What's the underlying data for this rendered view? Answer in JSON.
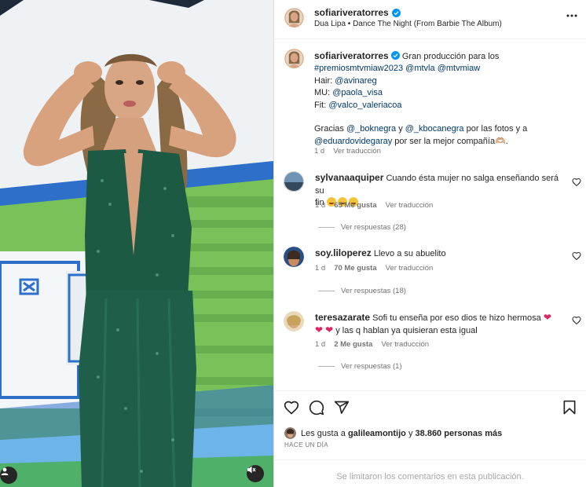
{
  "post": {
    "username": "sofiariveratorres",
    "audio": "Dua Lipa • Dance The Night (From Barbie The Album)"
  },
  "caption": {
    "username": "sofiariveratorres",
    "text_line1": "Gran producción para los",
    "line2_tag": "#premiosmtvmiaw2023",
    "line2_m1": "@mtvla",
    "line2_m2": "@mtvmiaw",
    "hair_label": "Hair:",
    "hair_mention": "@avinareg",
    "mu_label": "MU:",
    "mu_mention": "@paola_visa",
    "fit_label": "Fit:",
    "fit_mention": "@valco_valeriacoa",
    "thanks_1": "Gracias",
    "thanks_m1": "@_boknegra",
    "thanks_2": "y",
    "thanks_m2": "@_kbocanegra",
    "thanks_3": "por las fotos y a",
    "thanks_m3": "@eduardovidegaray",
    "thanks_4": "por ser la mejor compañía🫶🏼.",
    "time": "1 d",
    "see_translation": "Ver traducción"
  },
  "comments": [
    {
      "username": "sylvanaaquiper",
      "text": "Cuando ésta mujer no salga enseñando será su",
      "text2": "fin",
      "time": "1 d",
      "likes": "65 Me gusta",
      "see_translation": "Ver traducción",
      "replies": "Ver respuestas (28)"
    },
    {
      "username": "soy.liloperez",
      "text": "Llevo a su abuelito",
      "time": "1 d",
      "likes": "70 Me gusta",
      "see_translation": "Ver traducción",
      "replies": "Ver respuestas (18)"
    },
    {
      "username": "teresazarate",
      "text": "Sofi tu enseña por eso dios te hizo hermosa",
      "text2": "y las q hablan ya quisieran esta igual",
      "time": "1 d",
      "likes": "2 Me gusta",
      "see_translation": "Ver traducción",
      "replies": "Ver respuestas (1)"
    }
  ],
  "likes": {
    "prefix": "Les gusta a",
    "user": "galileamontijo",
    "middle": "y",
    "count": "38.860 personas más"
  },
  "time_ago": "HACE UN DÍA",
  "comments_limited": "Se limitaron los comentarios en esta publicación.",
  "colors": {
    "link": "#00376b",
    "verified": "#0095f6",
    "muted": "#737373",
    "dress": "#1d5a44"
  },
  "icons": [
    "verified-icon",
    "more-icon",
    "heart-icon",
    "comment-icon",
    "share-icon",
    "save-icon",
    "user-tag-icon",
    "mute-icon"
  ]
}
